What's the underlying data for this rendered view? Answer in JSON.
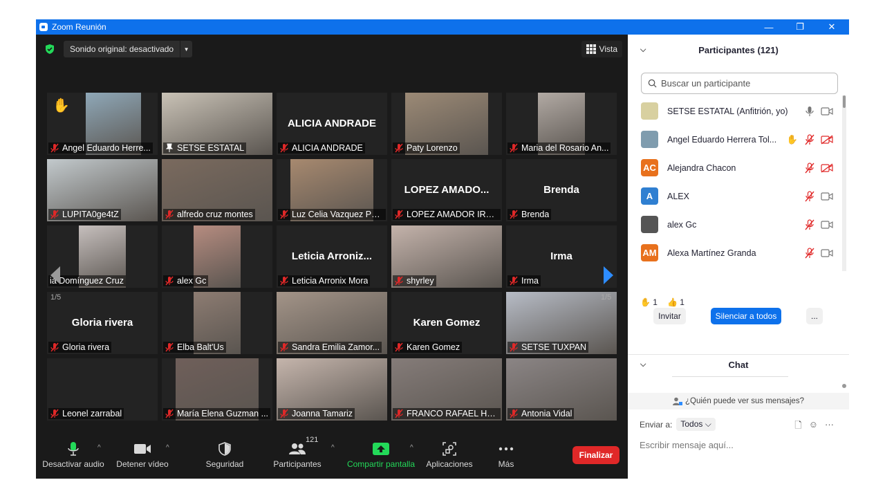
{
  "window": {
    "title": "Zoom Reunión",
    "controls": [
      "—",
      "❐",
      "✕"
    ]
  },
  "top": {
    "sound": "Sonido original: desactivado",
    "view": "Vista"
  },
  "page_indicator": {
    "left": "1/5",
    "right": "1/5"
  },
  "tiles": [
    {
      "name": "Angel Eduardo Herre...",
      "big": "",
      "photo": "#8fa8b8",
      "hand": true
    },
    {
      "name": "SETSE ESTATAL",
      "big": "",
      "photo": "#c9c2b6",
      "active": true,
      "pin": true
    },
    {
      "name": "ALICIA ANDRADE",
      "big": "ALICIA ANDRADE"
    },
    {
      "name": "Paty Lorenzo",
      "big": "",
      "photo": "#9c8a76"
    },
    {
      "name": "Maria del Rosario An...",
      "big": "",
      "photo": "#b2aaa4"
    },
    {
      "name": "LUPITA0ge4tZ",
      "big": "",
      "photo": "#c2c9cc"
    },
    {
      "name": "alfredo cruz montes",
      "big": "",
      "photo": "#7a6a5e"
    },
    {
      "name": "Luz Celia Vazquez Pul...",
      "big": "",
      "photo": "#a7896f"
    },
    {
      "name": "LOPEZ AMADOR IRAIS",
      "big": "LOPEZ  AMADO..."
    },
    {
      "name": "Brenda",
      "big": "Brenda"
    },
    {
      "name": "ia Domínguez Cruz",
      "big": "",
      "photo": "#c6bfbd",
      "nomute": true
    },
    {
      "name": "alex Gc",
      "big": "",
      "photo": "#b68c80"
    },
    {
      "name": "Leticia Arronix Mora",
      "big": "Leticia  Arroniz..."
    },
    {
      "name": "shyrley",
      "big": "",
      "photo": "#c4b3ab"
    },
    {
      "name": "Irma",
      "big": "Irma"
    },
    {
      "name": "Gloria rivera",
      "big": "Gloria rivera"
    },
    {
      "name": "Elba Balt'Us",
      "big": "",
      "photo": "#8d7c72"
    },
    {
      "name": "Sandra Emilia Zamor...",
      "big": "",
      "photo": "#a39488"
    },
    {
      "name": "Karen Gomez",
      "big": "Karen Gomez"
    },
    {
      "name": "SETSE TUXPAN",
      "big": "",
      "photo": "#b7bcc6"
    },
    {
      "name": "Leonel zarrabal",
      "big": ""
    },
    {
      "name": "María Elena Guzman ...",
      "big": "",
      "photo": "#6f5f5a"
    },
    {
      "name": "Joanna Tamariz",
      "big": "",
      "photo": "#c5b5ac"
    },
    {
      "name": "FRANCO RAFAEL HER...",
      "big": "",
      "photo": "#857c79"
    },
    {
      "name": "Antonia Vidal",
      "big": "",
      "photo": "#8b8585"
    }
  ],
  "toolbar": {
    "audio": "Desactivar audio",
    "video": "Detener vídeo",
    "security": "Seguridad",
    "participants": "Participantes",
    "participants_count": "121",
    "share": "Compartir pantalla",
    "apps": "Aplicaciones",
    "more": "Más",
    "end": "Finalizar"
  },
  "panel": {
    "title": "Participantes (121)",
    "search_placeholder": "Buscar un participante",
    "participants": [
      {
        "name": "SETSE ESTATAL (Anfitrión, yo)",
        "initials": "",
        "color": "#d8d0a0",
        "muted": false,
        "video_off": false
      },
      {
        "name": "Angel Eduardo Herrera Tol...",
        "initials": "",
        "color": "#7f9cae",
        "muted": true,
        "video_off": true,
        "hand": true
      },
      {
        "name": "Alejandra Chacon",
        "initials": "AC",
        "color": "#e8711d",
        "muted": true,
        "video_off": true
      },
      {
        "name": "ALEX",
        "initials": "A",
        "color": "#2f7fd1",
        "muted": true,
        "video_off": false
      },
      {
        "name": "alex Gc",
        "initials": "",
        "color": "#555555",
        "muted": true,
        "video_off": false
      },
      {
        "name": "Alexa Martínez Granda",
        "initials": "AM",
        "color": "#e8711d",
        "muted": true,
        "video_off": false
      }
    ],
    "reactions": [
      {
        "icon": "✋",
        "count": "1"
      },
      {
        "icon": "👍",
        "count": "1"
      }
    ],
    "invite": "Invitar",
    "mute_all": "Silenciar a todos",
    "more": "...",
    "chat_title": "Chat",
    "who_sees": "¿Quién puede ver sus mensajes?",
    "send_to_label": "Enviar a:",
    "send_to_value": "Todos",
    "chat_placeholder": "Escribir mensaje aquí..."
  }
}
